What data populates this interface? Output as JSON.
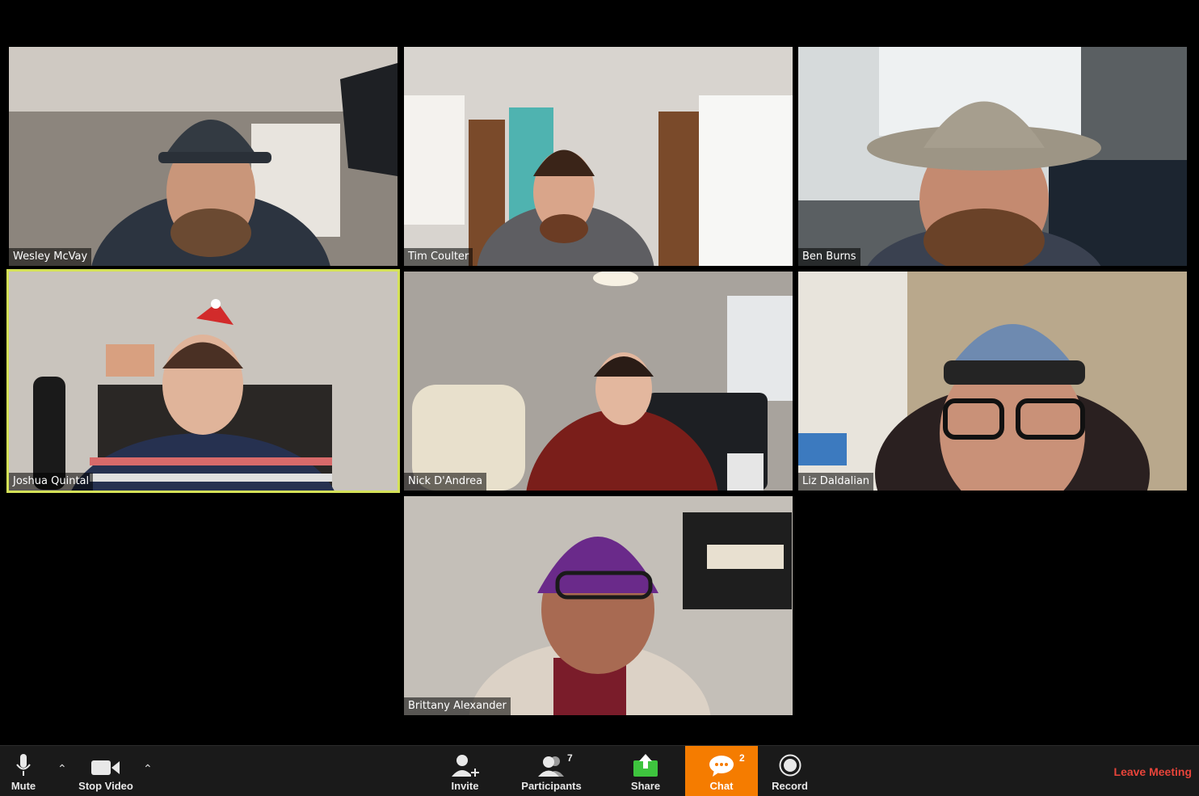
{
  "participants": [
    {
      "name": "Wesley McVay"
    },
    {
      "name": "Tim Coulter"
    },
    {
      "name": "Ben Burns"
    },
    {
      "name": "Joshua Quintal"
    },
    {
      "name": "Nick D'Andrea"
    },
    {
      "name": "Liz Daldalian"
    },
    {
      "name": "Brittany Alexander"
    }
  ],
  "toolbar": {
    "mute_label": "Mute",
    "video_label": "Stop Video",
    "invite_label": "Invite",
    "participants_label": "Participants",
    "participants_count": "7",
    "share_label": "Share",
    "chat_label": "Chat",
    "chat_count": "2",
    "record_label": "Record",
    "leave_label": "Leave Meeting"
  },
  "colors": {
    "active_speaker_border": "#d4e157",
    "chat_highlight": "#f57c00",
    "share_icon": "#3ec43e",
    "leave_text": "#e8443a"
  },
  "icons": [
    "microphone-icon",
    "video-camera-icon",
    "caret-up-icon",
    "invite-person-icon",
    "participants-icon",
    "share-screen-icon",
    "chat-bubble-icon",
    "record-icon"
  ]
}
